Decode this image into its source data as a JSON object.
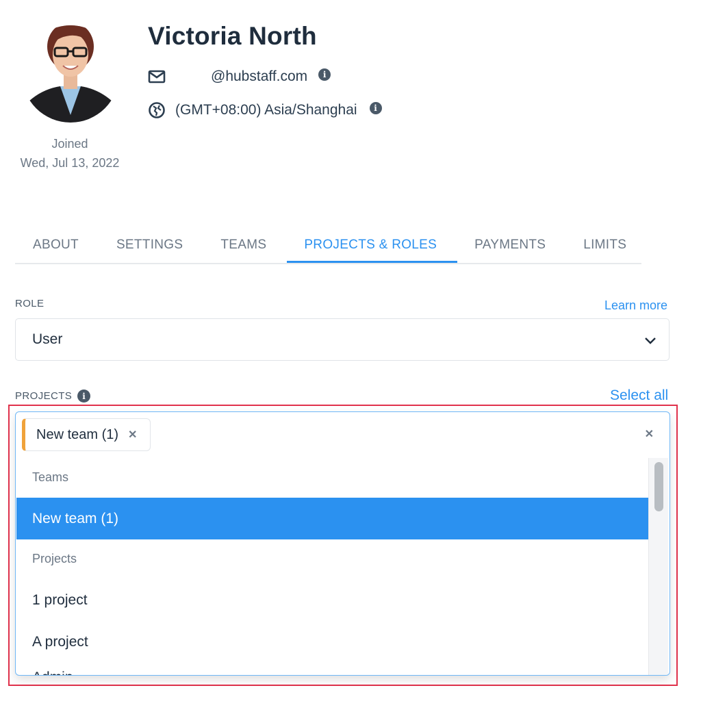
{
  "profile": {
    "name": "Victoria North",
    "email": "@hubstaff.com",
    "timezone": "(GMT+08:00) Asia/Shanghai",
    "joined_label": "Joined",
    "joined_date": "Wed, Jul 13, 2022"
  },
  "tabs": [
    {
      "label": "ABOUT",
      "active": false
    },
    {
      "label": "SETTINGS",
      "active": false
    },
    {
      "label": "TEAMS",
      "active": false
    },
    {
      "label": "PROJECTS & ROLES",
      "active": true
    },
    {
      "label": "PAYMENTS",
      "active": false
    },
    {
      "label": "LIMITS",
      "active": false
    }
  ],
  "role": {
    "label": "ROLE",
    "learn_more": "Learn more",
    "value": "User"
  },
  "projects": {
    "label": "PROJECTS",
    "select_all": "Select all",
    "selected_chip": "New team (1)",
    "groups": [
      {
        "header": "Teams",
        "options": [
          "New team (1)"
        ]
      },
      {
        "header": "Projects",
        "options": [
          "1 project",
          "A project",
          "Admin"
        ]
      }
    ]
  },
  "icons": {
    "email": "mail-icon",
    "timezone": "globe-icon",
    "info": "info-icon",
    "dropdown": "chevron-down-icon",
    "remove": "close-icon"
  },
  "colors": {
    "accent": "#2b91f0",
    "chip_accent": "#f0a23a",
    "highlight_frame": "#e0314b"
  }
}
